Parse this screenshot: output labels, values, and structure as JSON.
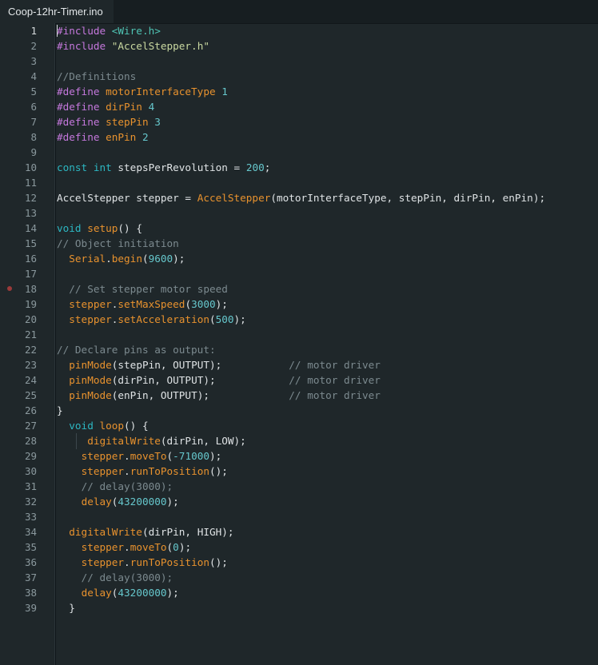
{
  "tabs": [
    {
      "label": "Coop-12hr-Timer.ino",
      "active": true
    }
  ],
  "editor": {
    "active_line": 1,
    "breakpoint_line": 18,
    "lines": [
      [
        {
          "t": "pre",
          "v": "#include "
        },
        {
          "t": "inc",
          "v": "<Wire.h>"
        }
      ],
      [
        {
          "t": "pre",
          "v": "#include "
        },
        {
          "t": "str",
          "v": "\"AccelStepper.h\""
        }
      ],
      [],
      [
        {
          "t": "com",
          "v": "//Definitions"
        }
      ],
      [
        {
          "t": "pre",
          "v": "#define "
        },
        {
          "t": "fn",
          "v": "motorInterfaceType"
        },
        {
          "t": "id",
          "v": " "
        },
        {
          "t": "num",
          "v": "1"
        }
      ],
      [
        {
          "t": "pre",
          "v": "#define "
        },
        {
          "t": "fn",
          "v": "dirPin"
        },
        {
          "t": "id",
          "v": " "
        },
        {
          "t": "num",
          "v": "4"
        }
      ],
      [
        {
          "t": "pre",
          "v": "#define "
        },
        {
          "t": "fn",
          "v": "stepPin"
        },
        {
          "t": "id",
          "v": " "
        },
        {
          "t": "num",
          "v": "3"
        }
      ],
      [
        {
          "t": "pre",
          "v": "#define "
        },
        {
          "t": "fn",
          "v": "enPin"
        },
        {
          "t": "id",
          "v": " "
        },
        {
          "t": "num",
          "v": "2"
        }
      ],
      [],
      [
        {
          "t": "kw",
          "v": "const"
        },
        {
          "t": "id",
          "v": " "
        },
        {
          "t": "kw",
          "v": "int"
        },
        {
          "t": "id",
          "v": " stepsPerRevolution = "
        },
        {
          "t": "num",
          "v": "200"
        },
        {
          "t": "id",
          "v": ";"
        }
      ],
      [],
      [
        {
          "t": "id",
          "v": "AccelStepper stepper = "
        },
        {
          "t": "fn",
          "v": "AccelStepper"
        },
        {
          "t": "id",
          "v": "(motorInterfaceType, stepPin, dirPin, enPin);"
        }
      ],
      [],
      [
        {
          "t": "kw",
          "v": "void"
        },
        {
          "t": "id",
          "v": " "
        },
        {
          "t": "fn",
          "v": "setup"
        },
        {
          "t": "id",
          "v": "() {"
        }
      ],
      [
        {
          "t": "com",
          "v": "// Object initiation"
        }
      ],
      [
        {
          "t": "id",
          "v": "  "
        },
        {
          "t": "fn",
          "v": "Serial"
        },
        {
          "t": "id",
          "v": "."
        },
        {
          "t": "fn",
          "v": "begin"
        },
        {
          "t": "id",
          "v": "("
        },
        {
          "t": "num",
          "v": "9600"
        },
        {
          "t": "id",
          "v": ");"
        }
      ],
      [],
      [
        {
          "t": "id",
          "v": "  "
        },
        {
          "t": "com",
          "v": "// Set stepper motor speed"
        }
      ],
      [
        {
          "t": "id",
          "v": "  "
        },
        {
          "t": "fn",
          "v": "stepper"
        },
        {
          "t": "id",
          "v": "."
        },
        {
          "t": "fn",
          "v": "setMaxSpeed"
        },
        {
          "t": "id",
          "v": "("
        },
        {
          "t": "num",
          "v": "3000"
        },
        {
          "t": "id",
          "v": ");"
        }
      ],
      [
        {
          "t": "id",
          "v": "  "
        },
        {
          "t": "fn",
          "v": "stepper"
        },
        {
          "t": "id",
          "v": "."
        },
        {
          "t": "fn",
          "v": "setAcceleration"
        },
        {
          "t": "id",
          "v": "("
        },
        {
          "t": "num",
          "v": "500"
        },
        {
          "t": "id",
          "v": ");"
        }
      ],
      [],
      [
        {
          "t": "com",
          "v": "// Declare pins as output:"
        }
      ],
      [
        {
          "t": "id",
          "v": "  "
        },
        {
          "t": "fn",
          "v": "pinMode"
        },
        {
          "t": "id",
          "v": "(stepPin, OUTPUT);           "
        },
        {
          "t": "com",
          "v": "// motor driver"
        }
      ],
      [
        {
          "t": "id",
          "v": "  "
        },
        {
          "t": "fn",
          "v": "pinMode"
        },
        {
          "t": "id",
          "v": "(dirPin, OUTPUT);            "
        },
        {
          "t": "com",
          "v": "// motor driver"
        }
      ],
      [
        {
          "t": "id",
          "v": "  "
        },
        {
          "t": "fn",
          "v": "pinMode"
        },
        {
          "t": "id",
          "v": "(enPin, OUTPUT);             "
        },
        {
          "t": "com",
          "v": "// motor driver"
        }
      ],
      [
        {
          "t": "id",
          "v": "}"
        }
      ],
      [
        {
          "t": "id",
          "v": "  "
        },
        {
          "t": "kw",
          "v": "void"
        },
        {
          "t": "id",
          "v": " "
        },
        {
          "t": "fn",
          "v": "loop"
        },
        {
          "t": "id",
          "v": "() {"
        }
      ],
      [
        {
          "t": "id",
          "v": "     "
        },
        {
          "t": "fn",
          "v": "digitalWrite"
        },
        {
          "t": "id",
          "v": "(dirPin, LOW);"
        }
      ],
      [
        {
          "t": "id",
          "v": "    "
        },
        {
          "t": "fn",
          "v": "stepper"
        },
        {
          "t": "id",
          "v": "."
        },
        {
          "t": "fn",
          "v": "moveTo"
        },
        {
          "t": "id",
          "v": "("
        },
        {
          "t": "num",
          "v": "-71000"
        },
        {
          "t": "id",
          "v": ");"
        }
      ],
      [
        {
          "t": "id",
          "v": "    "
        },
        {
          "t": "fn",
          "v": "stepper"
        },
        {
          "t": "id",
          "v": "."
        },
        {
          "t": "fn",
          "v": "runToPosition"
        },
        {
          "t": "id",
          "v": "();"
        }
      ],
      [
        {
          "t": "id",
          "v": "    "
        },
        {
          "t": "com",
          "v": "// delay(3000);"
        }
      ],
      [
        {
          "t": "id",
          "v": "    "
        },
        {
          "t": "fn",
          "v": "delay"
        },
        {
          "t": "id",
          "v": "("
        },
        {
          "t": "num",
          "v": "43200000"
        },
        {
          "t": "id",
          "v": ");"
        }
      ],
      [],
      [
        {
          "t": "id",
          "v": "  "
        },
        {
          "t": "fn",
          "v": "digitalWrite"
        },
        {
          "t": "id",
          "v": "(dirPin, HIGH);"
        }
      ],
      [
        {
          "t": "id",
          "v": "    "
        },
        {
          "t": "fn",
          "v": "stepper"
        },
        {
          "t": "id",
          "v": "."
        },
        {
          "t": "fn",
          "v": "moveTo"
        },
        {
          "t": "id",
          "v": "("
        },
        {
          "t": "num",
          "v": "0"
        },
        {
          "t": "id",
          "v": ");"
        }
      ],
      [
        {
          "t": "id",
          "v": "    "
        },
        {
          "t": "fn",
          "v": "stepper"
        },
        {
          "t": "id",
          "v": "."
        },
        {
          "t": "fn",
          "v": "runToPosition"
        },
        {
          "t": "id",
          "v": "();"
        }
      ],
      [
        {
          "t": "id",
          "v": "    "
        },
        {
          "t": "com",
          "v": "// delay(3000);"
        }
      ],
      [
        {
          "t": "id",
          "v": "    "
        },
        {
          "t": "fn",
          "v": "delay"
        },
        {
          "t": "id",
          "v": "("
        },
        {
          "t": "num",
          "v": "43200000"
        },
        {
          "t": "id",
          "v": ");"
        }
      ],
      [
        {
          "t": "id",
          "v": "  }"
        }
      ]
    ]
  },
  "colors": {
    "background": "#1f272a",
    "preprocessor": "#c578dd",
    "keyword": "#2cb7c2",
    "function": "#e8922e",
    "number": "#66c7cc",
    "comment": "#7c8a8f",
    "string": "#c9d8a0"
  }
}
